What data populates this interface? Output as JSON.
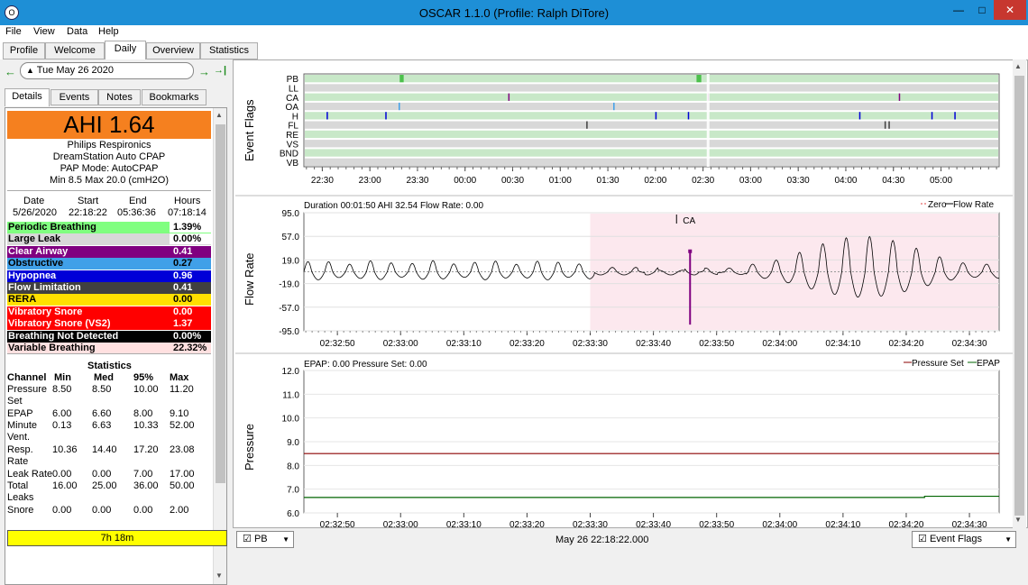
{
  "window": {
    "title": "OSCAR 1.1.0 (Profile: Ralph DiTore)",
    "min_glyph": "—",
    "max_glyph": "□",
    "close_glyph": "✕",
    "app_icon_glyph": "O"
  },
  "menu": [
    "File",
    "View",
    "Data",
    "Help"
  ],
  "tabs": [
    "Profile",
    "Welcome",
    "Daily",
    "Overview",
    "Statistics"
  ],
  "nav": {
    "prev_glyph": "←",
    "date": "Tue May 26 2020",
    "date_glyph": "▲",
    "next_glyph": "→",
    "last_glyph": "→|"
  },
  "subtabs": [
    "Details",
    "Events",
    "Notes",
    "Bookmarks"
  ],
  "details": {
    "ahi": "AHI 1.64",
    "machine_lines": [
      "Philips Respironics",
      "DreamStation Auto CPAP",
      "PAP Mode: AutoCPAP",
      "Min 8.5 Max 20.0 (cmH2O)"
    ],
    "session_headers": [
      "Date",
      "Start",
      "End",
      "Hours"
    ],
    "session_values": [
      "5/26/2020",
      "22:18:22",
      "05:36:36",
      "07:18:14"
    ],
    "events": [
      {
        "label": "Periodic Breathing",
        "value": "1.39%",
        "bg": "#80ff80",
        "fg": "#000000"
      },
      {
        "label": "Large Leak",
        "value": "0.00%",
        "bg": "#d8d8d8",
        "fg": "#000000"
      },
      {
        "label": "Clear Airway",
        "value": "0.41",
        "bg": "#800080",
        "fg": "#ffffff"
      },
      {
        "label": "Obstructive",
        "value": "0.27",
        "bg": "#40a0e8",
        "fg": "#000000"
      },
      {
        "label": "Hypopnea",
        "value": "0.96",
        "bg": "#0000d8",
        "fg": "#ffffff"
      },
      {
        "label": "Flow Limitation",
        "value": "0.41",
        "bg": "#404040",
        "fg": "#ffffff"
      },
      {
        "label": "RERA",
        "value": "0.00",
        "bg": "#ffe000",
        "fg": "#000000"
      },
      {
        "label": "Vibratory Snore",
        "value": "0.00",
        "bg": "#ff0000",
        "fg": "#ffffff"
      },
      {
        "label": "Vibratory Snore (VS2)",
        "value": "1.37",
        "bg": "#ff0000",
        "fg": "#ffffff"
      },
      {
        "label": "Breathing Not Detected",
        "value": "0.00%",
        "bg": "#000000",
        "fg": "#ffffff"
      },
      {
        "label": "Variable Breathing",
        "value": "22.32%",
        "bg": "#ffe0e0",
        "fg": "#000000"
      }
    ],
    "stats_title": "Statistics",
    "stats_headers": [
      "Channel",
      "Min",
      "Med",
      "95%",
      "Max"
    ],
    "stats_rows": [
      {
        "line1": "Pressure",
        "line2": "Set",
        "min": "8.50",
        "med": "8.50",
        "p95": "10.00",
        "max": "11.20"
      },
      {
        "line1": "EPAP",
        "line2": "",
        "min": "6.00",
        "med": "6.60",
        "p95": "8.00",
        "max": "9.10"
      },
      {
        "line1": "Minute",
        "line2": "Vent.",
        "min": "0.13",
        "med": "6.63",
        "p95": "10.33",
        "max": "52.00"
      },
      {
        "line1": "Resp.",
        "line2": "Rate",
        "min": "10.36",
        "med": "14.40",
        "p95": "17.20",
        "max": "23.08"
      },
      {
        "line1": "Leak Rate",
        "line2": "",
        "min": "0.00",
        "med": "0.00",
        "p95": "7.00",
        "max": "17.00"
      },
      {
        "line1": "Total",
        "line2": "Leaks",
        "min": "16.00",
        "med": "25.00",
        "p95": "36.00",
        "max": "50.00"
      },
      {
        "line1": "Snore",
        "line2": "",
        "min": "0.00",
        "med": "0.00",
        "p95": "0.00",
        "max": "2.00"
      }
    ],
    "total_duration": "7h 18m"
  },
  "event_flags": {
    "title": "Event Flags",
    "rows": [
      "PB",
      "LL",
      "CA",
      "OA",
      "H",
      "FL",
      "RE",
      "VS",
      "BND",
      "VB"
    ],
    "time_ticks": [
      "22:30",
      "23:00",
      "23:30",
      "00:00",
      "00:30",
      "01:00",
      "01:30",
      "02:00",
      "02:30",
      "03:00",
      "03:30",
      "04:00",
      "04:30",
      "05:00"
    ],
    "start_minutes": 0,
    "end_minutes": 438.25,
    "first_tick_minutes": 11.6,
    "cursor_minutes": 254.5,
    "markers": [
      {
        "row": "PB",
        "t": 60.4,
        "len": 2.5,
        "color": "#4cc04c"
      },
      {
        "row": "PB",
        "t": 247.5,
        "len": 3.0,
        "color": "#4cc04c"
      },
      {
        "row": "CA",
        "t": 128.8,
        "len": 0,
        "color": "#800080"
      },
      {
        "row": "CA",
        "t": 254.5,
        "len": 0,
        "color": "#800080"
      },
      {
        "row": "CA",
        "t": 375.0,
        "len": 0,
        "color": "#800080"
      },
      {
        "row": "OA",
        "t": 59.7,
        "len": 0,
        "color": "#40a0e8"
      },
      {
        "row": "OA",
        "t": 195.0,
        "len": 0,
        "color": "#40a0e8"
      },
      {
        "row": "H",
        "t": 14.3,
        "len": 0,
        "color": "#0000d8"
      },
      {
        "row": "H",
        "t": 51.3,
        "len": 0,
        "color": "#0000d8"
      },
      {
        "row": "H",
        "t": 221.5,
        "len": 0,
        "color": "#0000d8"
      },
      {
        "row": "H",
        "t": 242.0,
        "len": 0,
        "color": "#0000d8"
      },
      {
        "row": "H",
        "t": 350.0,
        "len": 0,
        "color": "#0000d8"
      },
      {
        "row": "H",
        "t": 395.5,
        "len": 0,
        "color": "#0000d8"
      },
      {
        "row": "H",
        "t": 410.0,
        "len": 0,
        "color": "#0000d8"
      },
      {
        "row": "FL",
        "t": 178.0,
        "len": 0,
        "color": "#404040"
      },
      {
        "row": "FL",
        "t": 366.0,
        "len": 0,
        "color": "#404040"
      },
      {
        "row": "FL",
        "t": 368.5,
        "len": 0,
        "color": "#404040"
      }
    ],
    "row_colors": [
      "#c8e8c8",
      "#d8d8d8"
    ]
  },
  "flow_rate": {
    "title": "Flow Rate",
    "header": "Duration 00:01:50 AHI 32.54 Flow Rate: 0.00",
    "legend": [
      "Zero",
      "Flow Rate"
    ],
    "legend_colors": [
      "#e04040",
      "#000000"
    ],
    "y_ticks": [
      "95.0",
      "57.0",
      "19.0",
      "-19.0",
      "-57.0",
      "-95.0"
    ],
    "y_max": 95,
    "y_min": -95,
    "x_ticks": [
      "02:32:50",
      "02:33:00",
      "02:33:10",
      "02:33:20",
      "02:33:30",
      "02:33:40",
      "02:33:50",
      "02:34:00",
      "02:34:10",
      "02:34:20",
      "02:34:30"
    ],
    "x_start_sec": 0,
    "x_end_sec": 110,
    "first_tick_sec": 5.3,
    "pb_region_start_sec": 45.3,
    "ca_label": "CA",
    "ca_sec": 61.1,
    "ca_color": "#800080",
    "ca_dot_value": 33,
    "ca_bottom_value": -85,
    "pb_shade": "#fce8ee"
  },
  "pressure": {
    "title": "Pressure",
    "header": "EPAP: 0.00 Pressure Set: 0.00",
    "legend": [
      "Pressure Set",
      "EPAP"
    ],
    "legend_colors": [
      "#8b0000",
      "#006400"
    ],
    "y_ticks": [
      "12.0",
      "11.0",
      "10.0",
      "9.0",
      "8.0",
      "7.0",
      "6.0"
    ],
    "y_max": 12,
    "y_min": 6,
    "pressure_set": 8.5,
    "epap_start": 6.65,
    "epap_step_sec": 98.2,
    "epap_end": 6.7,
    "x_ticks": [
      "02:32:50",
      "02:33:00",
      "02:33:10",
      "02:33:20",
      "02:33:30",
      "02:33:40",
      "02:33:50",
      "02:34:00",
      "02:34:10",
      "02:34:20",
      "02:34:30"
    ]
  },
  "bottom": {
    "pb_combo": "PB",
    "pb_check": "☑",
    "combo_arrow": "▼",
    "timestamp": "May 26 22:18:22.000",
    "flags_combo": "Event Flags",
    "flags_check": "☑"
  }
}
